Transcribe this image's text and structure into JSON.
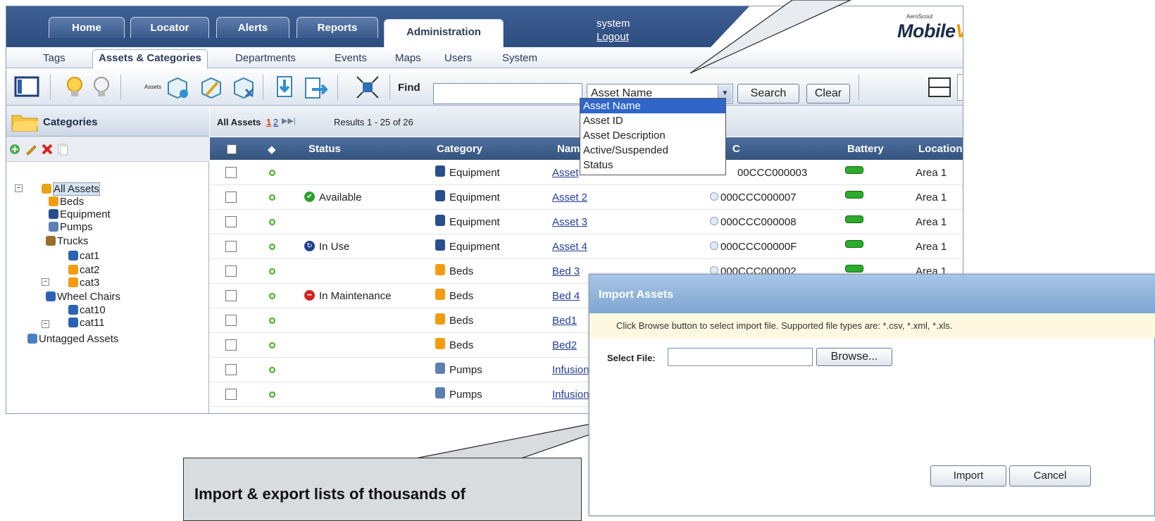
{
  "header": {
    "main_tabs": [
      "Home",
      "Locator",
      "Alerts",
      "Reports",
      "Administration"
    ],
    "active_main_tab": "Administration",
    "user": "system",
    "logout": "Logout",
    "brand_small": "AeroScout",
    "brand": "MobileVi"
  },
  "subnav": {
    "tabs": [
      "Tags",
      "Assets & Categories",
      "Departments",
      "Events",
      "Maps",
      "Users",
      "System"
    ],
    "active": "Assets & Categories"
  },
  "toolbar": {
    "assets_label": "Assets",
    "find_label": "Find",
    "find_value": "",
    "field_selected": "Asset Name",
    "search_label": "Search",
    "clear_label": "Clear"
  },
  "dropdown": {
    "options": [
      "Asset Name",
      "Asset ID",
      "Asset Description",
      "Active/Suspended",
      "Status"
    ],
    "highlighted": "Asset Name"
  },
  "categories": {
    "title": "Categories",
    "tree": [
      {
        "label": "All Assets",
        "level": 0,
        "selected": true
      },
      {
        "label": "Beds",
        "level": 1
      },
      {
        "label": "Equipment",
        "level": 1
      },
      {
        "label": "Pumps",
        "level": 1
      },
      {
        "label": "Trucks",
        "level": 1
      },
      {
        "label": "cat1",
        "level": 2
      },
      {
        "label": "cat2",
        "level": 2
      },
      {
        "label": "cat3",
        "level": 2
      },
      {
        "label": "Wheel Chairs",
        "level": 1
      },
      {
        "label": "cat10",
        "level": 2
      },
      {
        "label": "cat11",
        "level": 2
      },
      {
        "label": "Untagged Assets",
        "level": 0
      }
    ]
  },
  "results": {
    "title": "All Assets",
    "pages": [
      "1",
      "2"
    ],
    "summary": "Results 1 - 25 of 26"
  },
  "grid": {
    "columns": [
      "Status",
      "Category",
      "Name",
      "C",
      "Battery",
      "Location"
    ],
    "rows": [
      {
        "status": "",
        "category": "Equipment",
        "name": "Asset",
        "mac": "00CCC000003",
        "location": "Area 1"
      },
      {
        "status": "Available",
        "category": "Equipment",
        "name": "Asset 2",
        "mac": "000CCC000007",
        "location": "Area 1"
      },
      {
        "status": "",
        "category": "Equipment",
        "name": "Asset 3",
        "mac": "000CCC000008",
        "location": "Area 1"
      },
      {
        "status": "In Use",
        "category": "Equipment",
        "name": "Asset 4",
        "mac": "000CCC00000F",
        "location": "Area 1"
      },
      {
        "status": "",
        "category": "Beds",
        "name": "Bed 3",
        "mac": "000CCC000002",
        "location": "Area 1"
      },
      {
        "status": "In Maintenance",
        "category": "Beds",
        "name": "Bed 4",
        "mac": "",
        "location": ""
      },
      {
        "status": "",
        "category": "Beds",
        "name": "Bed1",
        "mac": "",
        "location": ""
      },
      {
        "status": "",
        "category": "Beds",
        "name": "Bed2",
        "mac": "",
        "location": ""
      },
      {
        "status": "",
        "category": "Pumps",
        "name": "Infusion",
        "mac": "",
        "location": ""
      },
      {
        "status": "",
        "category": "Pumps",
        "name": "Infusion",
        "mac": "",
        "location": ""
      }
    ]
  },
  "dialog": {
    "title": "Import Assets",
    "hint": "Click Browse button to select import file. Supported file types are: *.csv, *.xml, *.xls.",
    "file_label": "Select File:",
    "file_value": "",
    "browse_label": "Browse...",
    "import_label": "Import",
    "cancel_label": "Cancel"
  },
  "note": "Import & export lists of thousands of"
}
